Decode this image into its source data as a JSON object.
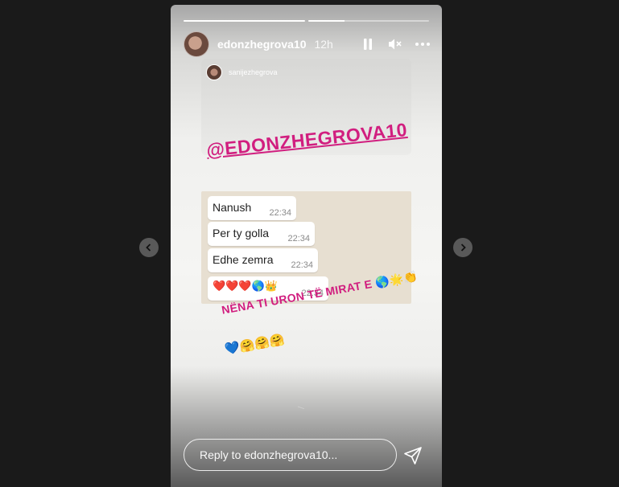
{
  "story": {
    "username": "edonzhegrova10",
    "time": "12h",
    "progress": [
      1,
      0.3
    ],
    "shared_post": {
      "username": "sanijezhegrova"
    },
    "mention": "@EDONZHEGROVA10",
    "messages": [
      {
        "text": "Nanush",
        "time": "22:34"
      },
      {
        "text": "Per ty golla",
        "time": "22:34"
      },
      {
        "text": "Edhe zemra",
        "time": "22:34"
      },
      {
        "text": "❤️❤️❤️🌎👑",
        "time": "22:34"
      }
    ],
    "caption_line1": "NËNA TI URON TË MIRAT E 🌎🌟👏",
    "caption_line2": "💙🤗🤗🤗",
    "reply_placeholder": "Reply to edonzhegrova10..."
  },
  "colors": {
    "accent": "#d11e7f",
    "background": "#1a1a1a"
  },
  "icons": [
    "pause-icon",
    "mute-icon",
    "more-icon",
    "send-icon",
    "chevron-left-icon",
    "chevron-right-icon"
  ]
}
